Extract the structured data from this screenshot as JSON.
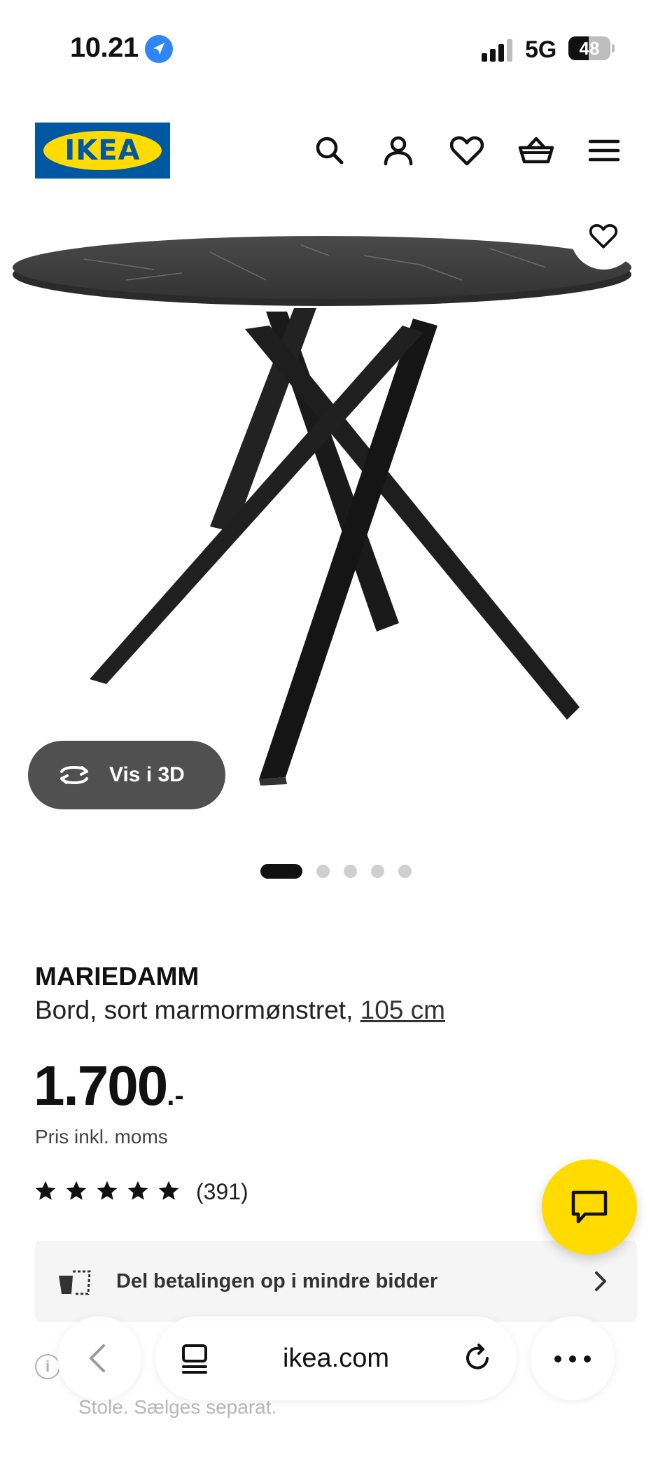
{
  "status_bar": {
    "time": "10.21",
    "network": "5G",
    "battery": "48",
    "battery_level_percent": 48
  },
  "header": {
    "logo_text": "IKEA",
    "icons": [
      "search-icon",
      "user-icon",
      "heart-icon",
      "basket-icon",
      "menu-icon"
    ]
  },
  "gallery": {
    "view_3d_label": "Vis i 3D",
    "image_count": 5,
    "active_index": 0
  },
  "product": {
    "name": "MARIEDAMM",
    "description": "Bord, sort marmormønstret, ",
    "size_link": "105 cm",
    "price": "1.700",
    "price_suffix": ".-",
    "price_note": "Pris inkl. moms",
    "rating_stars": 5,
    "review_count": "(391)"
  },
  "payment_banner": {
    "text": "Del betalingen op i mindre bidder"
  },
  "info_line": {
    "text": "Stole. Sælges separat."
  },
  "browser": {
    "url": "ikea.com"
  },
  "colors": {
    "ikea_blue": "#0058a3",
    "ikea_yellow": "#ffdb00",
    "location_blue": "#2f86f6",
    "button_dark": "#505050"
  }
}
